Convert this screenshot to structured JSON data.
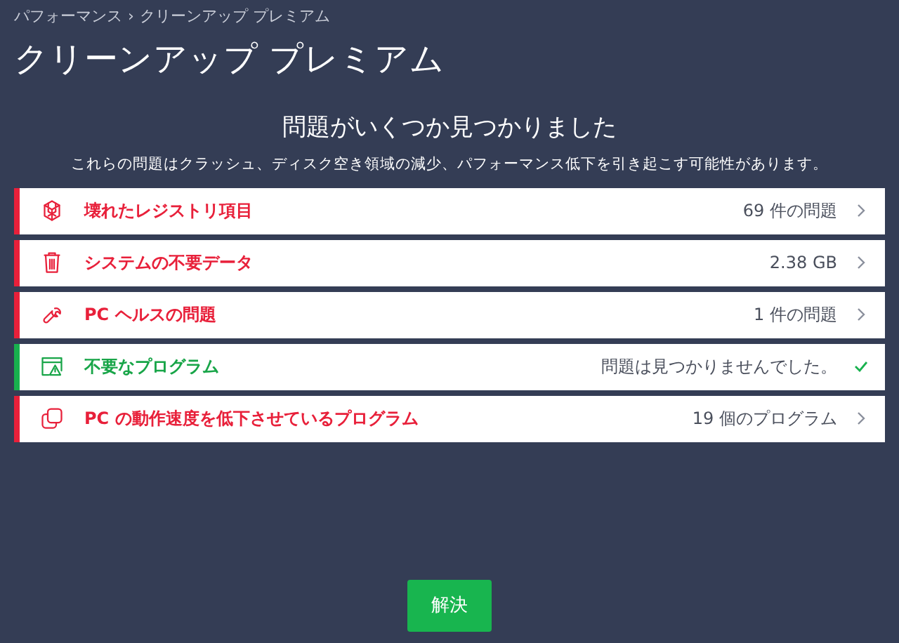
{
  "breadcrumb": {
    "parent": "パフォーマンス",
    "separator": "›",
    "current": "クリーンアップ プレミアム"
  },
  "title": "クリーンアップ プレミアム",
  "heading": "問題がいくつか見つかりました",
  "description": "これらの問題はクラッシュ、ディスク空き領域の減少、パフォーマンス低下を引き起こす可能性があります。",
  "items": [
    {
      "label": "壊れたレジストリ項目",
      "result": "69 件の問題",
      "kind": "issue"
    },
    {
      "label": "システムの不要データ",
      "result": "2.38 GB",
      "kind": "issue"
    },
    {
      "label": "PC ヘルスの問題",
      "result": "1 件の問題",
      "kind": "issue"
    },
    {
      "label": "不要なプログラム",
      "result": "問題は見つかりませんでした。",
      "kind": "clean"
    },
    {
      "label": "PC の動作速度を低下させているプログラム",
      "result": "19 個のプログラム",
      "kind": "issue"
    }
  ],
  "button": "解決"
}
